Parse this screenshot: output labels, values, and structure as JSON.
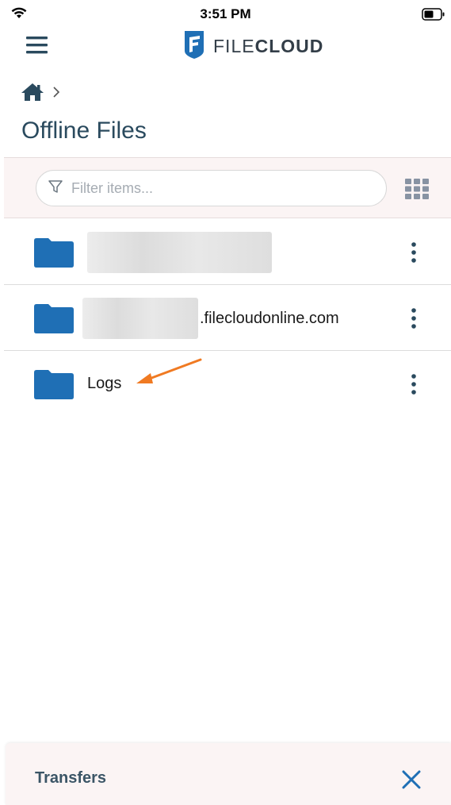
{
  "status_bar": {
    "time": "3:51 PM",
    "wifi_icon": "wifi-icon",
    "battery_icon": "battery-icon"
  },
  "header": {
    "menu_icon": "hamburger-menu-icon",
    "logo_text_light": "FILE",
    "logo_text_bold": "CLOUD",
    "logo_color": "#1f6fb5"
  },
  "breadcrumb": {
    "home_icon": "home-icon",
    "separator_icon": "chevron-right-icon"
  },
  "page": {
    "title": "Offline Files"
  },
  "filter": {
    "placeholder": "Filter items...",
    "value": "",
    "filter_icon": "filter-funnel-icon",
    "view_toggle_icon": "grid-view-icon"
  },
  "files": [
    {
      "name": "",
      "name_suffix": "",
      "redacted": true,
      "icon": "folder-icon",
      "menu_icon": "more-vertical-icon"
    },
    {
      "name": "",
      "name_suffix": ".filecloudonline.com",
      "redacted": true,
      "icon": "folder-icon",
      "menu_icon": "more-vertical-icon"
    },
    {
      "name": "Logs",
      "name_suffix": "",
      "redacted": false,
      "icon": "folder-icon",
      "menu_icon": "more-vertical-icon"
    }
  ],
  "annotation": {
    "arrow_color": "#f07a22",
    "arrow_icon": "annotation-arrow-icon"
  },
  "transfers": {
    "label": "Transfers",
    "close_icon": "close-icon",
    "accent_color": "#1f6fb5"
  },
  "colors": {
    "folder": "#1f6fb5",
    "title": "#2a4a5e",
    "filter_bar_bg": "#fbf4f4"
  }
}
